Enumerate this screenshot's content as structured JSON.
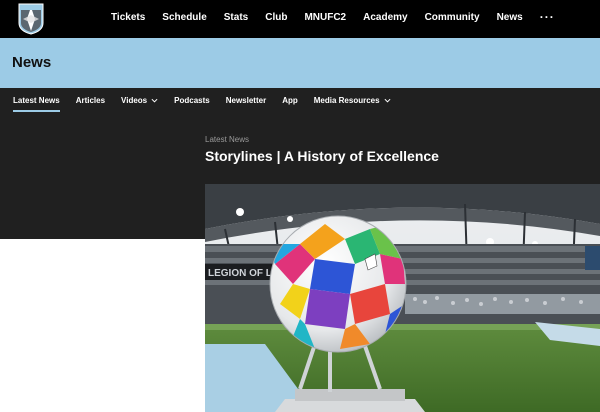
{
  "top_nav": {
    "items": [
      "Tickets",
      "Schedule",
      "Stats",
      "Club",
      "MNUFC2",
      "Academy",
      "Community",
      "News"
    ],
    "more_label": "···"
  },
  "section": {
    "title": "News"
  },
  "sub_nav": {
    "items": [
      {
        "label": "Latest News",
        "active": true,
        "dropdown": false
      },
      {
        "label": "Articles",
        "active": false,
        "dropdown": false
      },
      {
        "label": "Videos",
        "active": false,
        "dropdown": true
      },
      {
        "label": "Podcasts",
        "active": false,
        "dropdown": false
      },
      {
        "label": "Newsletter",
        "active": false,
        "dropdown": false
      },
      {
        "label": "App",
        "active": false,
        "dropdown": false
      },
      {
        "label": "Media Resources",
        "active": false,
        "dropdown": true
      }
    ]
  },
  "article": {
    "eyebrow": "Latest News",
    "headline": "Storylines | A History of Excellence",
    "image_alt": "Match ball on a pedestal in the stadium",
    "stadium_banner_text": "LEGION OF LOONS"
  },
  "colors": {
    "accent_blue": "#9ccbe6",
    "top_bar": "#000000",
    "dark_panel": "#202020"
  }
}
